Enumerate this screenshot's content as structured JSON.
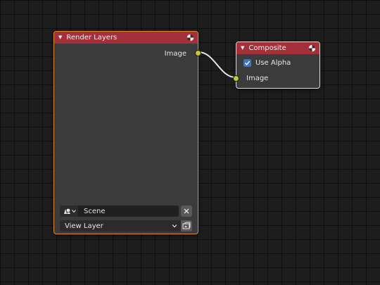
{
  "links": [
    {
      "from": "render_layers.output_image",
      "to": "composite.input_image"
    }
  ],
  "render_layers": {
    "title": "Render Layers",
    "header_color": "#a3303a",
    "border_color": "#e08a2e",
    "icon": "render-result-icon",
    "output_label": "Image",
    "socket_color": "#c7c729",
    "scene_icon": "scene-icon",
    "scene_value": "Scene",
    "scene_clear_icon": "close-icon",
    "view_layer_value": "View Layer",
    "view_layer_chevron": "chevron-down-icon",
    "render_layer_icon": "render-layer-icon"
  },
  "composite": {
    "title": "Composite",
    "header_color": "#a3303a",
    "icon": "render-result-icon",
    "use_alpha_label": "Use Alpha",
    "use_alpha_checked": true,
    "checkbox_color": "#4772b3",
    "input_label": "Image",
    "socket_color": "#c7c729"
  }
}
